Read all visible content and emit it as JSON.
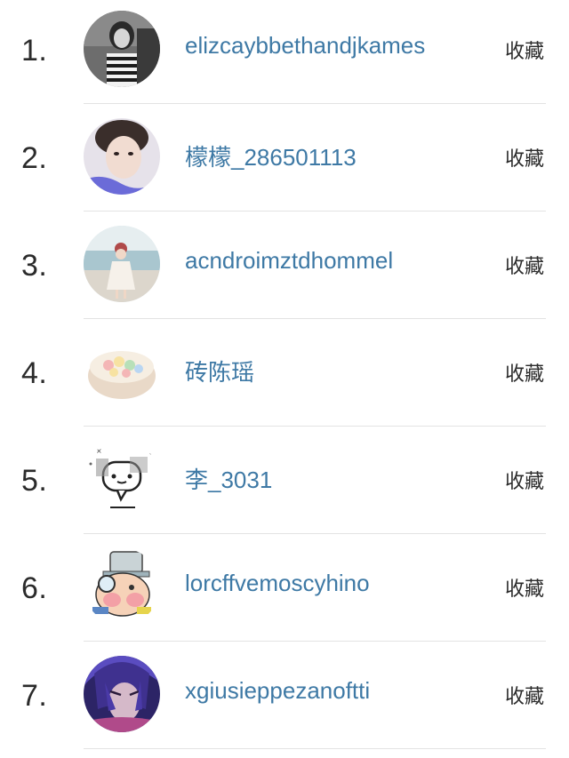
{
  "users": [
    {
      "rank": "1.",
      "name": "elizcaybbethandjkames",
      "action": "收藏",
      "avatar": "portrait-bw-avatar"
    },
    {
      "rank": "2.",
      "name": "檬檬_286501113",
      "action": "收藏",
      "avatar": "young-man-avatar"
    },
    {
      "rank": "3.",
      "name": "acndroimztdhommel",
      "action": "收藏",
      "avatar": "beach-girl-avatar"
    },
    {
      "rank": "4.",
      "name": "砖陈瑶",
      "action": "收藏",
      "avatar": "dessert-bowl-avatar"
    },
    {
      "rank": "5.",
      "name": "李_3031",
      "action": "收藏",
      "avatar": "cartoon-chat-avatar"
    },
    {
      "rank": "6.",
      "name": "lorcffvemoscyhino",
      "action": "收藏",
      "avatar": "anime-detective-avatar"
    },
    {
      "rank": "7.",
      "name": "xgiusieppezanoftti",
      "action": "收藏",
      "avatar": "anime-purple-hair-avatar"
    }
  ],
  "colors": {
    "username": "#3e79a5",
    "text": "#2b2b2b",
    "divider": "#e3e3e3"
  }
}
